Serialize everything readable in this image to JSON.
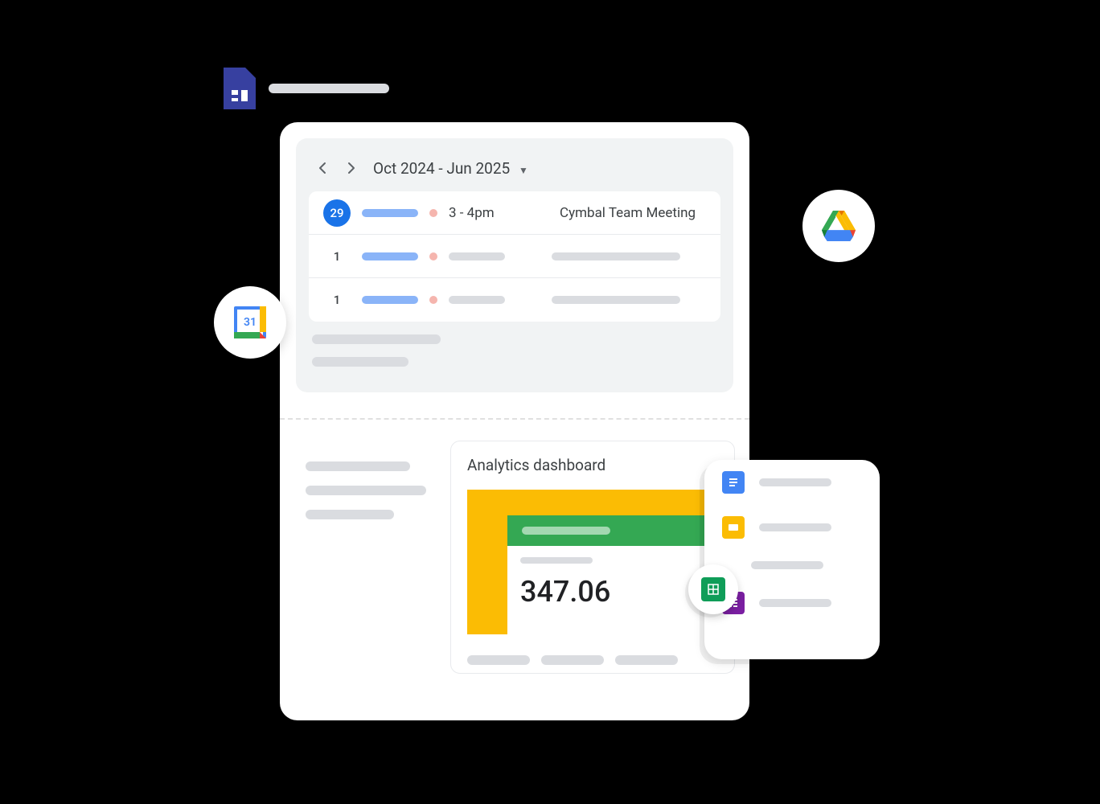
{
  "calendar": {
    "range_label": "Oct 2024 - Jun 2025",
    "events": [
      {
        "day": "29",
        "active": true,
        "time": "3 - 4pm",
        "title": "Cymbal Team Meeting"
      },
      {
        "day": "1",
        "active": false,
        "time": "",
        "title": ""
      },
      {
        "day": "1",
        "active": false,
        "time": "",
        "title": ""
      }
    ],
    "icon_day": "31"
  },
  "analytics": {
    "title": "Analytics dashboard",
    "value": "347.06"
  },
  "file_types": [
    {
      "name": "docs",
      "color": "#4285f4"
    },
    {
      "name": "slides",
      "color": "#fbbc04"
    },
    {
      "name": "sheets",
      "color": "#0f9d58"
    },
    {
      "name": "forms",
      "color": "#7b1fa2"
    }
  ]
}
